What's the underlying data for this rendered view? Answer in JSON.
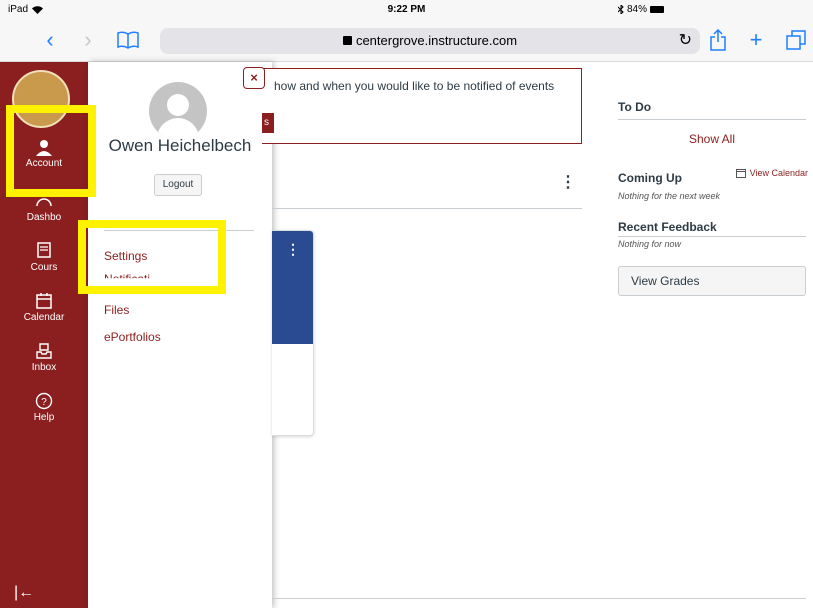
{
  "status_bar": {
    "device": "iPad",
    "time": "9:22 PM",
    "battery": "84%"
  },
  "browser": {
    "url": "centergrove.instructure.com"
  },
  "global_nav": {
    "items": [
      {
        "label": "Account",
        "icon": "user-icon"
      },
      {
        "label": "Dashbo",
        "icon": "dashboard-icon"
      },
      {
        "label": "Cours",
        "icon": "courses-icon"
      },
      {
        "label": "Calendar",
        "icon": "calendar-icon"
      },
      {
        "label": "Inbox",
        "icon": "inbox-icon"
      },
      {
        "label": "Help",
        "icon": "help-icon"
      }
    ],
    "brand_color": "#8b1e1e"
  },
  "account_tray": {
    "user_name": "Owen Heichelbech",
    "logout_label": "Logout",
    "close_label": "×",
    "links": [
      "Settings",
      "Notificati",
      "Files",
      "ePortfolios"
    ]
  },
  "main": {
    "notice_text": "how and when you would like to be notified of events",
    "notice_button": "s",
    "course_card_color": "#2a4a92"
  },
  "sidebar": {
    "todo_title": "To Do",
    "show_all": "Show All",
    "coming_up_title": "Coming Up",
    "view_calendar": "View Calendar",
    "coming_up_empty": "Nothing for the next week",
    "feedback_title": "Recent Feedback",
    "feedback_empty": "Nothing for now",
    "view_grades": "View Grades"
  },
  "highlight_color": "#fff200"
}
